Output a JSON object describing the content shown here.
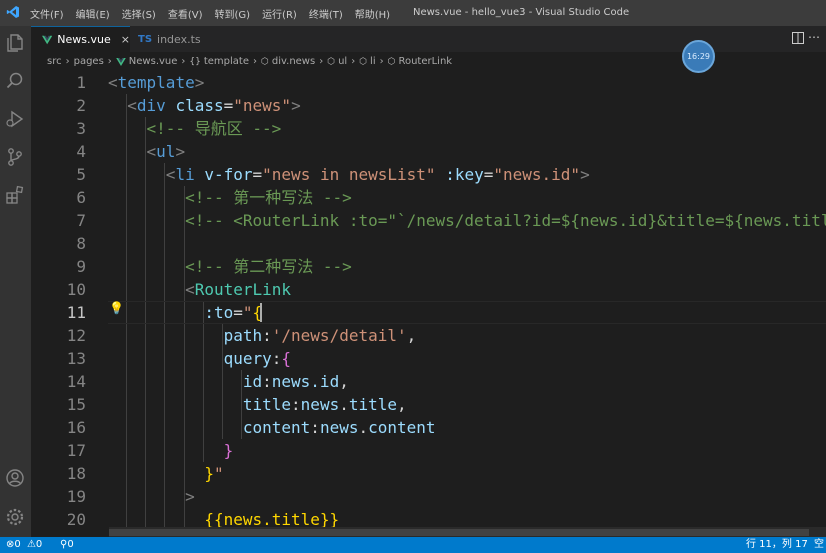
{
  "app": {
    "menu": [
      "文件(F)",
      "编辑(E)",
      "选择(S)",
      "查看(V)",
      "转到(G)",
      "运行(R)",
      "终端(T)",
      "帮助(H)"
    ],
    "window_title": "News.vue - hello_vue3 - Visual Studio Code"
  },
  "tabs": [
    {
      "label": "News.vue",
      "active": true,
      "icon": "vue-icon",
      "close": "×"
    },
    {
      "label": "index.ts",
      "active": false,
      "icon": "ts-icon",
      "icon_text": "TS"
    }
  ],
  "breadcrumb": [
    "src",
    "pages",
    "News.vue",
    "template",
    "div.news",
    "ul",
    "li",
    "RouterLink"
  ],
  "breadcrumb_icons": {
    "template": "{}",
    "element": "⬡"
  },
  "editor": {
    "current_line": 11,
    "lines": [
      {
        "n": "1"
      },
      {
        "n": "2"
      },
      {
        "n": "3"
      },
      {
        "n": "4"
      },
      {
        "n": "5"
      },
      {
        "n": "6"
      },
      {
        "n": "7"
      },
      {
        "n": "8"
      },
      {
        "n": "9"
      },
      {
        "n": "10"
      },
      {
        "n": "11"
      },
      {
        "n": "12"
      },
      {
        "n": "13"
      },
      {
        "n": "14"
      },
      {
        "n": "15"
      },
      {
        "n": "16"
      },
      {
        "n": "17"
      },
      {
        "n": "18"
      },
      {
        "n": "19"
      },
      {
        "n": "20"
      }
    ],
    "code": {
      "template_tag": "template",
      "div_tag": "div",
      "class_attr": "class",
      "class_value": "\"news\"",
      "comment_nav": "<!-- 导航区 -->",
      "ul_tag": "ul",
      "li_tag": "li",
      "vfor_attr": "v-for",
      "vfor_value": "\"news in newsList\"",
      "key_attr": ":key",
      "key_value": "\"news.id\"",
      "comment_way1": "<!-- 第一种写法 -->",
      "comment_line7": "<!-- <RouterLink :to=\"`/news/detail?id=${news.id}&title=${news.title",
      "comment_way2": "<!-- 第二种写法 -->",
      "routerlink_tag": "RouterLink",
      "to_attr": ":to",
      "path_key": "path",
      "path_value": "'/news/detail'",
      "query_key": "query",
      "id_key": "id",
      "id_value": "news.id",
      "title_key": "title",
      "news_obj": "news",
      "title_prop": "title",
      "content_key": "content",
      "content_prop": "content",
      "mustache_title": "{{news.title}}"
    }
  },
  "status": {
    "errors": "0",
    "warnings": "0",
    "ports": "0",
    "position": "行 11，列 17",
    "encoding": "空"
  },
  "overlay": {
    "time_badge": "16:29"
  },
  "colors": {
    "statusbar": "#007acc",
    "titlebar": "#3c3c3c",
    "activitybar": "#333333",
    "editor_bg": "#1e1e1e"
  }
}
